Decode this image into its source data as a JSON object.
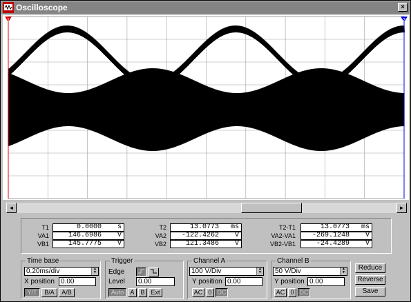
{
  "window": {
    "title": "Oscilloscope",
    "close_glyph": "×"
  },
  "scrollbar": {
    "left_glyph": "◄",
    "right_glyph": "►"
  },
  "cursors": {
    "t1_marker": "1",
    "t2_marker": "2"
  },
  "readout": {
    "col1": {
      "rows": [
        {
          "label": "T1",
          "value": "0.0000",
          "unit": "s"
        },
        {
          "label": "VA1",
          "value": "146.6986",
          "unit": "V"
        },
        {
          "label": "VB1",
          "value": "145.7775",
          "unit": "V"
        }
      ]
    },
    "col2": {
      "rows": [
        {
          "label": "T2",
          "value": "13.0773",
          "unit": "ms"
        },
        {
          "label": "VA2",
          "value": "-122.4262",
          "unit": "V"
        },
        {
          "label": "VB2",
          "value": "121.3486",
          "unit": "V"
        }
      ]
    },
    "col3": {
      "rows": [
        {
          "label": "T2-T1",
          "value": "13.0773",
          "unit": "ms"
        },
        {
          "label": "VA2-VA1",
          "value": "-269.1248",
          "unit": "V"
        },
        {
          "label": "VB2-VB1",
          "value": "-24.4289",
          "unit": "V"
        }
      ]
    }
  },
  "timebase": {
    "title": "Time base",
    "value": "0.20ms/div",
    "xpos_label": "X position",
    "xpos_value": "0.00",
    "mode_buttons": [
      "Y/T",
      "B/A",
      "A/B"
    ]
  },
  "trigger": {
    "title": "Trigger",
    "edge_label": "Edge",
    "level_label": "Level",
    "level_value": "0.00",
    "source_buttons": [
      "Auto",
      "A",
      "B",
      "Ext"
    ]
  },
  "channel_a": {
    "title": "Channel A",
    "value": "100 V/Div",
    "ypos_label": "Y position",
    "ypos_value": "0.00",
    "coupling": [
      "AC",
      "0",
      "DC"
    ]
  },
  "channel_b": {
    "title": "Channel B",
    "value": "50 V/Div",
    "ypos_label": "Y position",
    "ypos_value": "0.00",
    "coupling": [
      "AC",
      "0",
      "DC"
    ]
  },
  "actions": {
    "reduce": "Reduce",
    "reverse": "Reverse",
    "save": "Save"
  },
  "colors": {
    "trace": "#000000",
    "grid": "#a0a0a0",
    "cursor_t1": "#e00000",
    "cursor_t2": "#0000e0",
    "screen_bg": "#ffffff"
  }
}
